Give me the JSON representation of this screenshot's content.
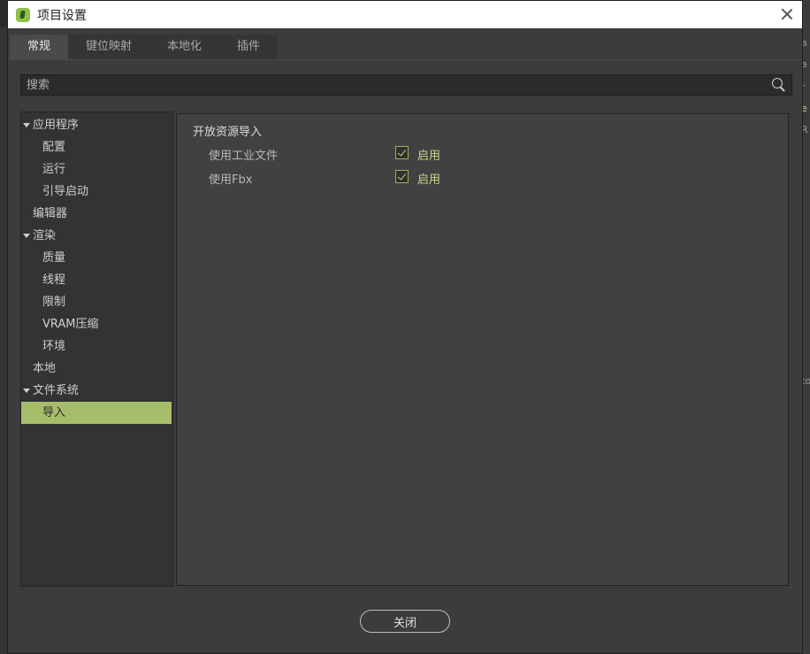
{
  "window": {
    "title": "项目设置"
  },
  "background": {
    "side_texts": [
      "a",
      "a",
      "r",
      "e",
      "R",
      "to"
    ]
  },
  "tabs": [
    {
      "label": "常规",
      "active": true
    },
    {
      "label": "键位映射",
      "active": false
    },
    {
      "label": "本地化",
      "active": false
    },
    {
      "label": "插件",
      "active": false
    }
  ],
  "search": {
    "placeholder": "搜索",
    "value": ""
  },
  "tree": {
    "items": [
      {
        "label": "应用程序",
        "level": 0,
        "expanded": true
      },
      {
        "label": "配置",
        "level": 1
      },
      {
        "label": "运行",
        "level": 1
      },
      {
        "label": "引导启动",
        "level": 1
      },
      {
        "label": "编辑器",
        "level": 0
      },
      {
        "label": "渲染",
        "level": 0,
        "expanded": true
      },
      {
        "label": "质量",
        "level": 1
      },
      {
        "label": "线程",
        "level": 1
      },
      {
        "label": "限制",
        "level": 1
      },
      {
        "label": "VRAM压缩",
        "level": 1
      },
      {
        "label": "环境",
        "level": 1
      },
      {
        "label": "本地",
        "level": 0
      },
      {
        "label": "文件系统",
        "level": 0,
        "expanded": true
      },
      {
        "label": "导入",
        "level": 1,
        "selected": true
      }
    ]
  },
  "content": {
    "section_title": "开放资源导入",
    "settings": [
      {
        "label": "使用工业文件",
        "checked": true,
        "value_label": "启用"
      },
      {
        "label": "使用Fbx",
        "checked": true,
        "value_label": "启用"
      }
    ]
  },
  "footer": {
    "close_label": "关闭"
  },
  "colors": {
    "accent": "#a6bd6a",
    "panel": "#414141",
    "background": "#3c3c3c"
  }
}
